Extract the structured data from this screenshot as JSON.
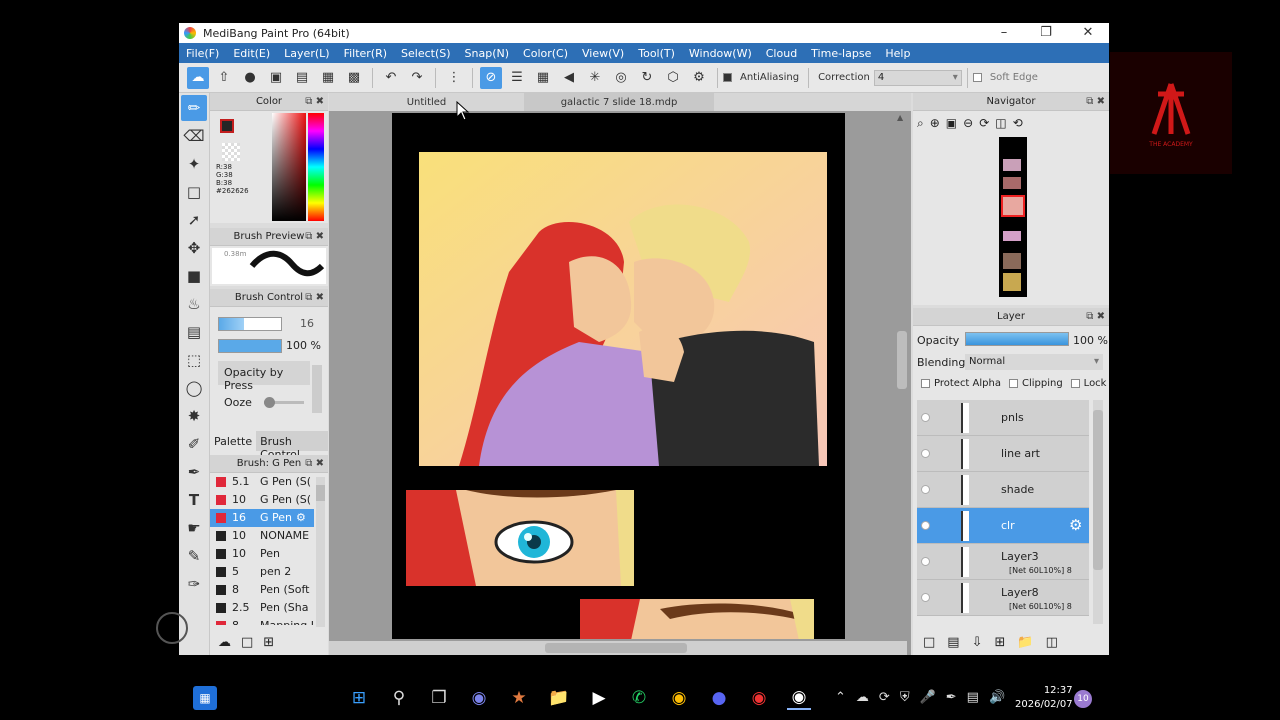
{
  "window": {
    "title": "MediBang Paint Pro (64bit)",
    "min_icon": "minimize-icon",
    "restore_icon": "restore-icon",
    "close_icon": "close-icon"
  },
  "menu": [
    "File(F)",
    "Edit(E)",
    "Layer(L)",
    "Filter(R)",
    "Select(S)",
    "Snap(N)",
    "Color(C)",
    "View(V)",
    "Tool(T)",
    "Window(W)",
    "Cloud",
    "Time-lapse",
    "Help"
  ],
  "toolbar": {
    "antialiasing": "AntiAliasing",
    "correction_label": "Correction",
    "correction_value": "4",
    "soft_edge": "Soft Edge"
  },
  "tabs": {
    "untitled": "Untitled",
    "galactic": "galactic 7 slide 18.mdp"
  },
  "color_panel": {
    "title": "Color",
    "rgb": [
      "R:38",
      "G:38",
      "B:38",
      "#262626"
    ],
    "main_color": "#262626",
    "accent": "#c21e1e"
  },
  "brush_preview": {
    "title": "Brush Preview",
    "size_label": "0.38m"
  },
  "brush_control": {
    "title": "Brush Control",
    "size": "16",
    "opacity": "100 %",
    "opacity_by_pressure": "Opacity by Press",
    "ooze": "Ooze"
  },
  "palette_tabs": [
    "Palette",
    "Brush Control"
  ],
  "brush_list": {
    "title": "Brush: G Pen",
    "items": [
      {
        "size": "5.1",
        "name": "G Pen (S(",
        "color": "#e0283a"
      },
      {
        "size": "10",
        "name": "G Pen (S(",
        "color": "#e0283a"
      },
      {
        "size": "16",
        "name": "G Pen",
        "color": "#e0283a"
      },
      {
        "size": "10",
        "name": "NONAME",
        "color": "#222222"
      },
      {
        "size": "10",
        "name": "Pen",
        "color": "#222222"
      },
      {
        "size": "5",
        "name": "pen 2",
        "color": "#222222"
      },
      {
        "size": "8",
        "name": "Pen (Soft",
        "color": "#222222"
      },
      {
        "size": "2.5",
        "name": "Pen (Sha",
        "color": "#222222"
      },
      {
        "size": "8",
        "name": "Mapping I",
        "color": "#e0283a"
      }
    ]
  },
  "navigator": {
    "title": "Navigator"
  },
  "layer_panel": {
    "title": "Layer",
    "opacity_label": "Opacity",
    "opacity_value": "100 %",
    "blending_label": "Blending",
    "blending_value": "Normal",
    "protect_alpha": "Protect Alpha",
    "clipping": "Clipping",
    "lock": "Lock",
    "layers": [
      {
        "name": "pnls",
        "sub": ""
      },
      {
        "name": "line art",
        "sub": ""
      },
      {
        "name": "shade",
        "sub": ""
      },
      {
        "name": "clr",
        "sub": ""
      },
      {
        "name": "Layer3",
        "sub": "[Net 60L10%] 8"
      },
      {
        "name": "Layer8",
        "sub": "[Net 60L10%] 8"
      }
    ]
  },
  "watermark": {
    "text": "THE ACADEMY"
  },
  "taskbar": {
    "time": "12:37",
    "date": "2026/02/07",
    "notif_count": "10"
  }
}
